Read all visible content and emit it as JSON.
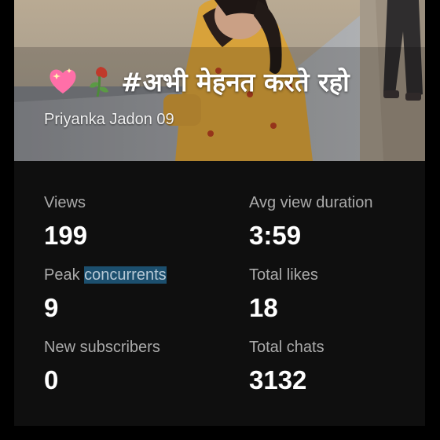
{
  "video": {
    "title": "#अभी मेहनत करते रहो",
    "author": "Priyanka Jadon 09",
    "title_emojis": [
      "sparkling-heart-icon",
      "wilted-flower-icon"
    ]
  },
  "stats": {
    "views": {
      "label": "Views",
      "value": "199"
    },
    "avg_view_duration": {
      "label": "Avg view duration",
      "value": "3:59"
    },
    "peak_concurrents": {
      "label_prefix": "Peak ",
      "label_highlight": "concurrents",
      "value": "9"
    },
    "total_likes": {
      "label": "Total likes",
      "value": "18"
    },
    "new_subscribers": {
      "label": "New subscribers",
      "value": "0"
    },
    "total_chats": {
      "label": "Total chats",
      "value": "3132"
    }
  },
  "colors": {
    "card_background": "#0f0f0f",
    "label_gray": "#aaaaaa",
    "value_white": "#ffffff",
    "selection_highlight": "#1c4f6e"
  }
}
